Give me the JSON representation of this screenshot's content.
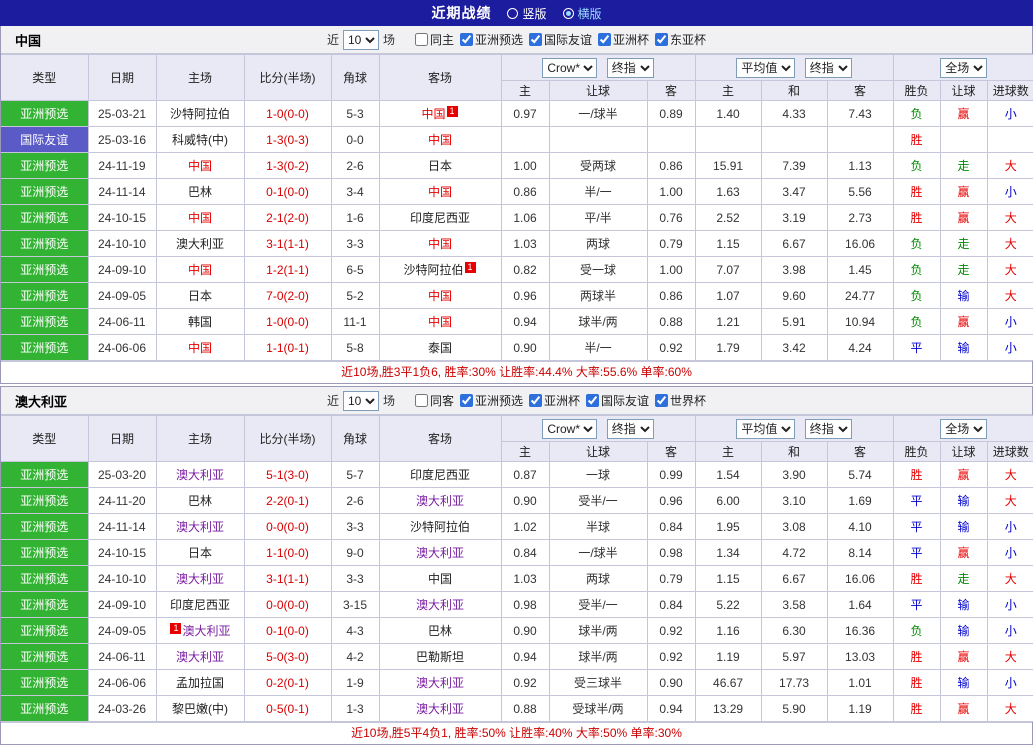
{
  "topbar": {
    "title": "近期战绩",
    "layout_options": [
      {
        "label": "竖版",
        "selected": false
      },
      {
        "label": "横版",
        "selected": true
      }
    ]
  },
  "value_colors": {
    "胜": "#e60000",
    "平": "#0000cc",
    "负": "#008a00",
    "赢": "#e60000",
    "走": "#008a00",
    "输": "#0000cc",
    "大": "#e60000",
    "小": "#0000cc"
  },
  "table_head": {
    "col_type": "类型",
    "col_date": "日期",
    "col_home": "主场",
    "col_score": "比分(半场)",
    "col_corner": "角球",
    "col_away": "客场",
    "odds_company": "Crow*",
    "odds_time": "终指",
    "avg_source": "平均值",
    "avg_time": "终指",
    "fulltime": "全场",
    "sub_odds_home": "主",
    "sub_handicap": "让球",
    "sub_odds_away": "客",
    "sub_avg_home": "主",
    "sub_avg_draw": "和",
    "sub_avg_away": "客",
    "sub_result": "胜负",
    "sub_cover": "让球",
    "sub_total": "进球数"
  },
  "sections": [
    {
      "title": "中国",
      "filters": {
        "near_label": "近",
        "recent_value": "10",
        "matches_label": "场",
        "checkboxes": [
          {
            "label": "同主",
            "checked": false
          },
          {
            "label": "亚洲预选",
            "checked": true
          },
          {
            "label": "国际友谊",
            "checked": true
          },
          {
            "label": "亚洲杯",
            "checked": true
          },
          {
            "label": "东亚杯",
            "checked": true
          }
        ]
      },
      "rows": [
        {
          "type": "亚洲预选",
          "type_bg": "#33b333",
          "date": "25-03-21",
          "home": "沙特阿拉伯",
          "score": "1-0(0-0)",
          "corner": "5-3",
          "away": "中国",
          "away_c": "#e60000",
          "away_sup_r": "1",
          "odds_home": "0.97",
          "handicap": "一/球半",
          "odds_away": "0.89",
          "avg_home": "1.40",
          "avg_draw": "4.33",
          "avg_away": "7.43",
          "result": "负",
          "cover": "赢",
          "total": "小"
        },
        {
          "type": "国际友谊",
          "type_bg": "#5b5bc7",
          "date": "25-03-16",
          "home": "科威特(中)",
          "score": "1-3(0-3)",
          "corner": "0-0",
          "away": "中国",
          "away_c": "#e60000",
          "odds_home": "",
          "handicap": "",
          "odds_away": "",
          "avg_home": "",
          "avg_draw": "",
          "avg_away": "",
          "result": "胜",
          "cover": "",
          "total": ""
        },
        {
          "type": "亚洲预选",
          "type_bg": "#33b333",
          "date": "24-11-19",
          "home": "中国",
          "home_c": "#e60000",
          "score": "1-3(0-2)",
          "corner": "2-6",
          "away": "日本",
          "odds_home": "1.00",
          "handicap": "受两球",
          "odds_away": "0.86",
          "avg_home": "15.91",
          "avg_draw": "7.39",
          "avg_away": "1.13",
          "result": "负",
          "cover": "走",
          "total": "大"
        },
        {
          "type": "亚洲预选",
          "type_bg": "#33b333",
          "date": "24-11-14",
          "home": "巴林",
          "score": "0-1(0-0)",
          "corner": "3-4",
          "away": "中国",
          "away_c": "#e60000",
          "odds_home": "0.86",
          "handicap": "半/一",
          "odds_away": "1.00",
          "avg_home": "1.63",
          "avg_draw": "3.47",
          "avg_away": "5.56",
          "result": "胜",
          "cover": "赢",
          "total": "小"
        },
        {
          "type": "亚洲预选",
          "type_bg": "#33b333",
          "date": "24-10-15",
          "home": "中国",
          "home_c": "#e60000",
          "score": "2-1(2-0)",
          "corner": "1-6",
          "away": "印度尼西亚",
          "odds_home": "1.06",
          "handicap": "平/半",
          "odds_away": "0.76",
          "avg_home": "2.52",
          "avg_draw": "3.19",
          "avg_away": "2.73",
          "result": "胜",
          "cover": "赢",
          "total": "大"
        },
        {
          "type": "亚洲预选",
          "type_bg": "#33b333",
          "date": "24-10-10",
          "home": "澳大利亚",
          "score": "3-1(1-1)",
          "corner": "3-3",
          "away": "中国",
          "away_c": "#e60000",
          "odds_home": "1.03",
          "handicap": "两球",
          "odds_away": "0.79",
          "avg_home": "1.15",
          "avg_draw": "6.67",
          "avg_away": "16.06",
          "result": "负",
          "cover": "走",
          "total": "大"
        },
        {
          "type": "亚洲预选",
          "type_bg": "#33b333",
          "date": "24-09-10",
          "home": "中国",
          "home_c": "#e60000",
          "score": "1-2(1-1)",
          "corner": "6-5",
          "away": "沙特阿拉伯",
          "away_sup_r": "1",
          "odds_home": "0.82",
          "handicap": "受一球",
          "odds_away": "1.00",
          "avg_home": "7.07",
          "avg_draw": "3.98",
          "avg_away": "1.45",
          "result": "负",
          "cover": "走",
          "total": "大"
        },
        {
          "type": "亚洲预选",
          "type_bg": "#33b333",
          "date": "24-09-05",
          "home": "日本",
          "score": "7-0(2-0)",
          "corner": "5-2",
          "away": "中国",
          "away_c": "#e60000",
          "odds_home": "0.96",
          "handicap": "两球半",
          "odds_away": "0.86",
          "avg_home": "1.07",
          "avg_draw": "9.60",
          "avg_away": "24.77",
          "result": "负",
          "cover": "输",
          "total": "大"
        },
        {
          "type": "亚洲预选",
          "type_bg": "#33b333",
          "date": "24-06-11",
          "home": "韩国",
          "score": "1-0(0-0)",
          "corner": "11-1",
          "away": "中国",
          "away_c": "#e60000",
          "odds_home": "0.94",
          "handicap": "球半/两",
          "odds_away": "0.88",
          "avg_home": "1.21",
          "avg_draw": "5.91",
          "avg_away": "10.94",
          "result": "负",
          "cover": "赢",
          "total": "小"
        },
        {
          "type": "亚洲预选",
          "type_bg": "#33b333",
          "date": "24-06-06",
          "home": "中国",
          "home_c": "#e60000",
          "score": "1-1(0-1)",
          "corner": "5-8",
          "away": "泰国",
          "odds_home": "0.90",
          "handicap": "半/一",
          "odds_away": "0.92",
          "avg_home": "1.79",
          "avg_draw": "3.42",
          "avg_away": "4.24",
          "result": "平",
          "cover": "输",
          "total": "小"
        }
      ],
      "summary": "近10场,胜3平1负6, 胜率:30% 让胜率:44.4% 大率:55.6% 单率:60%"
    },
    {
      "title": "澳大利亚",
      "filters": {
        "near_label": "近",
        "recent_value": "10",
        "matches_label": "场",
        "checkboxes": [
          {
            "label": "同客",
            "checked": false
          },
          {
            "label": "亚洲预选",
            "checked": true
          },
          {
            "label": "亚洲杯",
            "checked": true
          },
          {
            "label": "国际友谊",
            "checked": true
          },
          {
            "label": "世界杯",
            "checked": true
          }
        ]
      },
      "rows": [
        {
          "type": "亚洲预选",
          "type_bg": "#33b333",
          "date": "25-03-20",
          "home": "澳大利亚",
          "home_c": "#7b1fa2",
          "score": "5-1(3-0)",
          "corner": "5-7",
          "away": "印度尼西亚",
          "odds_home": "0.87",
          "handicap": "一球",
          "odds_away": "0.99",
          "avg_home": "1.54",
          "avg_draw": "3.90",
          "avg_away": "5.74",
          "result": "胜",
          "cover": "赢",
          "total": "大"
        },
        {
          "type": "亚洲预选",
          "type_bg": "#33b333",
          "date": "24-11-20",
          "home": "巴林",
          "score": "2-2(0-1)",
          "corner": "2-6",
          "away": "澳大利亚",
          "away_c": "#7b1fa2",
          "odds_home": "0.90",
          "handicap": "受半/一",
          "odds_away": "0.96",
          "avg_home": "6.00",
          "avg_draw": "3.10",
          "avg_away": "1.69",
          "result": "平",
          "cover": "输",
          "total": "大"
        },
        {
          "type": "亚洲预选",
          "type_bg": "#33b333",
          "date": "24-11-14",
          "home": "澳大利亚",
          "home_c": "#7b1fa2",
          "score": "0-0(0-0)",
          "corner": "3-3",
          "away": "沙特阿拉伯",
          "odds_home": "1.02",
          "handicap": "半球",
          "odds_away": "0.84",
          "avg_home": "1.95",
          "avg_draw": "3.08",
          "avg_away": "4.10",
          "result": "平",
          "cover": "输",
          "total": "小"
        },
        {
          "type": "亚洲预选",
          "type_bg": "#33b333",
          "date": "24-10-15",
          "home": "日本",
          "score": "1-1(0-0)",
          "corner": "9-0",
          "away": "澳大利亚",
          "away_c": "#7b1fa2",
          "odds_home": "0.84",
          "handicap": "一/球半",
          "odds_away": "0.98",
          "avg_home": "1.34",
          "avg_draw": "4.72",
          "avg_away": "8.14",
          "result": "平",
          "cover": "赢",
          "total": "小"
        },
        {
          "type": "亚洲预选",
          "type_bg": "#33b333",
          "date": "24-10-10",
          "home": "澳大利亚",
          "home_c": "#7b1fa2",
          "score": "3-1(1-1)",
          "corner": "3-3",
          "away": "中国",
          "odds_home": "1.03",
          "handicap": "两球",
          "odds_away": "0.79",
          "avg_home": "1.15",
          "avg_draw": "6.67",
          "avg_away": "16.06",
          "result": "胜",
          "cover": "走",
          "total": "大"
        },
        {
          "type": "亚洲预选",
          "type_bg": "#33b333",
          "date": "24-09-10",
          "home": "印度尼西亚",
          "score": "0-0(0-0)",
          "corner": "3-15",
          "away": "澳大利亚",
          "away_c": "#7b1fa2",
          "odds_home": "0.98",
          "handicap": "受半/一",
          "odds_away": "0.84",
          "avg_home": "5.22",
          "avg_draw": "3.58",
          "avg_away": "1.64",
          "result": "平",
          "cover": "输",
          "total": "小"
        },
        {
          "type": "亚洲预选",
          "type_bg": "#33b333",
          "date": "24-09-05",
          "home": "澳大利亚",
          "home_c": "#7b1fa2",
          "home_sup_l": "1",
          "score": "0-1(0-0)",
          "corner": "4-3",
          "away": "巴林",
          "odds_home": "0.90",
          "handicap": "球半/两",
          "odds_away": "0.92",
          "avg_home": "1.16",
          "avg_draw": "6.30",
          "avg_away": "16.36",
          "result": "负",
          "cover": "输",
          "total": "小"
        },
        {
          "type": "亚洲预选",
          "type_bg": "#33b333",
          "date": "24-06-11",
          "home": "澳大利亚",
          "home_c": "#7b1fa2",
          "score": "5-0(3-0)",
          "corner": "4-2",
          "away": "巴勒斯坦",
          "odds_home": "0.94",
          "handicap": "球半/两",
          "odds_away": "0.92",
          "avg_home": "1.19",
          "avg_draw": "5.97",
          "avg_away": "13.03",
          "result": "胜",
          "cover": "赢",
          "total": "大"
        },
        {
          "type": "亚洲预选",
          "type_bg": "#33b333",
          "date": "24-06-06",
          "home": "孟加拉国",
          "score": "0-2(0-1)",
          "corner": "1-9",
          "away": "澳大利亚",
          "away_c": "#7b1fa2",
          "odds_home": "0.92",
          "handicap": "受三球半",
          "odds_away": "0.90",
          "avg_home": "46.67",
          "avg_draw": "17.73",
          "avg_away": "1.01",
          "result": "胜",
          "cover": "输",
          "total": "小"
        },
        {
          "type": "亚洲预选",
          "type_bg": "#33b333",
          "date": "24-03-26",
          "home": "黎巴嫩(中)",
          "score": "0-5(0-1)",
          "corner": "1-3",
          "away": "澳大利亚",
          "away_c": "#7b1fa2",
          "odds_home": "0.88",
          "handicap": "受球半/两",
          "odds_away": "0.94",
          "avg_home": "13.29",
          "avg_draw": "5.90",
          "avg_away": "1.19",
          "result": "胜",
          "cover": "赢",
          "total": "大"
        }
      ],
      "summary": "近10场,胜5平4负1, 胜率:50% 让胜率:40% 大率:50% 单率:30%"
    }
  ]
}
